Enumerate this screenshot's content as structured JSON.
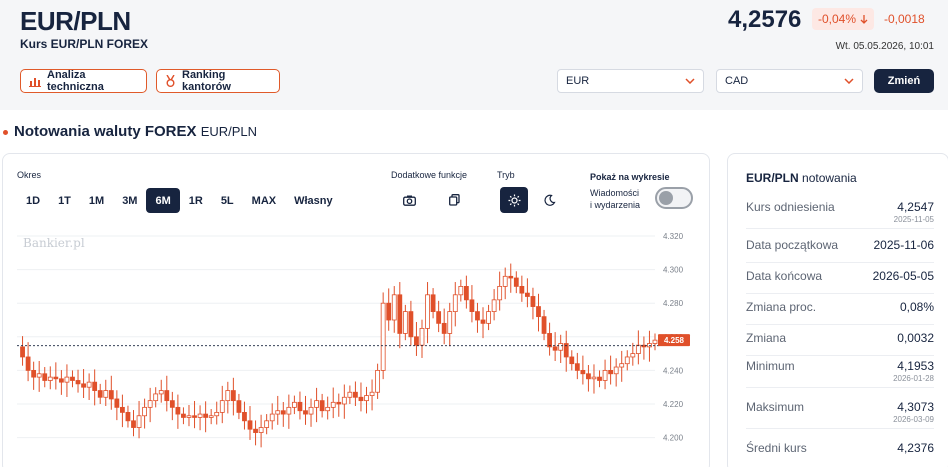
{
  "header": {
    "pair": "EUR/PLN",
    "subtitle": "Kurs EUR/PLN FOREX",
    "rate": "4,2576",
    "change_pct": "-0,04%",
    "change_abs": "-0,0018",
    "datetime": "Wt. 05.05.2026, 10:01",
    "btn_tech": "Analiza techniczna",
    "btn_ranking": "Ranking kantorów",
    "select_from": "EUR",
    "select_to": "CAD",
    "btn_change": "Zmień",
    "accent": "#e0502a",
    "dark": "#17243f"
  },
  "section": {
    "title": "Notowania waluty FOREX",
    "subtitle": "EUR/PLN"
  },
  "controls": {
    "okres_label": "Okres",
    "periods": [
      "1D",
      "1T",
      "1M",
      "3M",
      "6M",
      "1R",
      "5L",
      "MAX",
      "Własny"
    ],
    "active_period": "6M",
    "functions_label": "Dodatkowe funkcje",
    "mode_label": "Tryb",
    "show_label": "Pokaż na wykresie",
    "news_label_1": "Wiadomości",
    "news_label_2": "i wydarzenia",
    "news_toggle": false,
    "watermark": "Bankier.pl"
  },
  "chart_data": {
    "type": "candlestick",
    "y_ticks": [
      "4.320",
      "4.300",
      "4.280",
      "4.260",
      "4.240",
      "4.220",
      "4.200"
    ],
    "ylim": [
      4.195,
      4.32
    ],
    "current_value": "4.258",
    "reference_line": 4.2547,
    "close_series": [
      4.254,
      4.248,
      4.24,
      4.236,
      4.238,
      4.234,
      4.236,
      4.235,
      4.233,
      4.236,
      4.234,
      4.232,
      4.23,
      4.233,
      4.228,
      4.224,
      4.228,
      4.223,
      4.218,
      4.215,
      4.21,
      4.206,
      4.213,
      4.218,
      4.222,
      4.226,
      4.228,
      4.222,
      4.218,
      4.214,
      4.212,
      4.213,
      4.212,
      4.214,
      4.212,
      4.213,
      4.215,
      4.222,
      4.228,
      4.222,
      4.215,
      4.21,
      4.205,
      4.203,
      4.206,
      4.21,
      4.214,
      4.216,
      4.214,
      4.218,
      4.221,
      4.216,
      4.214,
      4.218,
      4.222,
      4.216,
      4.218,
      4.221,
      4.22,
      4.224,
      4.227,
      4.224,
      4.222,
      4.225,
      4.227,
      4.24,
      4.28,
      4.27,
      4.285,
      4.262,
      4.275,
      4.26,
      4.255,
      4.265,
      4.285,
      4.275,
      4.268,
      4.262,
      4.275,
      4.285,
      4.29,
      4.282,
      4.275,
      4.27,
      4.268,
      4.275,
      4.282,
      4.29,
      4.296,
      4.295,
      4.29,
      4.286,
      4.284,
      4.278,
      4.272,
      4.262,
      4.254,
      4.252,
      4.256,
      4.248,
      4.244,
      4.24,
      4.238,
      4.235,
      4.236,
      4.234,
      4.24,
      4.238,
      4.242,
      4.244,
      4.248,
      4.25,
      4.255,
      4.254,
      4.256,
      4.258
    ]
  },
  "side": {
    "title_bold": "EUR/PLN",
    "title_rest": "notowania",
    "rows": [
      {
        "label": "Kurs odniesienia",
        "value": "4,2547",
        "date": "2025-11-05"
      },
      {
        "label": "Data początkowa",
        "value": "2025-11-06",
        "date": ""
      },
      {
        "label": "Data końcowa",
        "value": "2026-05-05",
        "date": ""
      },
      {
        "label": "Zmiana proc.",
        "value": "0,08%",
        "date": ""
      },
      {
        "label": "Zmiana",
        "value": "0,0032",
        "date": ""
      },
      {
        "label": "Minimum",
        "value": "4,1953",
        "date": "2026-01-28"
      },
      {
        "label": "Maksimum",
        "value": "4,3073",
        "date": "2026-03-09"
      },
      {
        "label": "Średni kurs",
        "value": "4,2376",
        "date": ""
      }
    ]
  }
}
